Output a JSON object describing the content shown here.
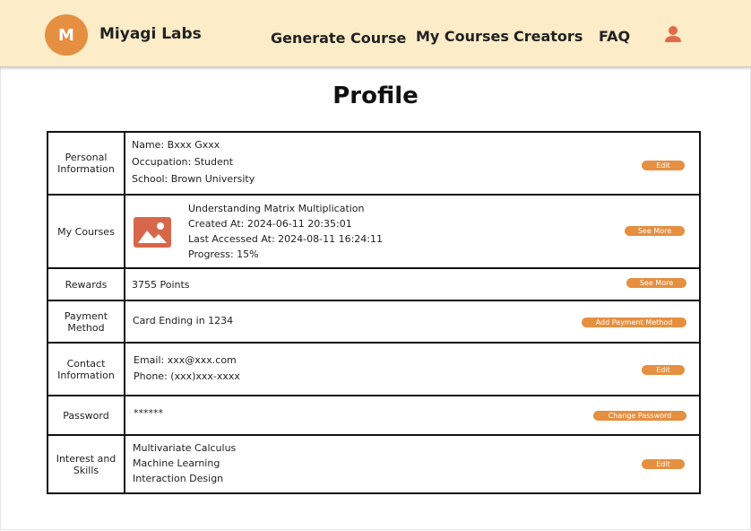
{
  "header": {
    "logo_letter": "M",
    "brand": "Miyagi Labs",
    "nav": {
      "generate_course": "Generate Course",
      "my_courses": "My Courses",
      "creators": "Creators",
      "faq": "FAQ"
    },
    "user_icon": "user-icon"
  },
  "page_title": "Profile",
  "colors": {
    "accent": "#e58f40",
    "header_bg": "#fcecc8",
    "image_placeholder": "#d7674a"
  },
  "sections": {
    "personal": {
      "label": "Personal Information",
      "lines": [
        "Name: Bxxx Gxxx",
        "Occupation: Student",
        "School: Brown University"
      ],
      "button": "Edit"
    },
    "courses": {
      "label": "My Courses",
      "image_icon": "image-icon",
      "lines": [
        "Understanding Matrix Multiplication",
        "Created At: 2024-06-11 20:35:01",
        "Last Accessed At: 2024-08-11 16:24:11",
        "Progress: 15%"
      ],
      "button": "See More"
    },
    "rewards": {
      "label": "Rewards",
      "value": "3755 Points",
      "button": "See More"
    },
    "payment": {
      "label": "Payment Method",
      "value": "Card Ending in 1234",
      "button": "Add Payment Method"
    },
    "contact": {
      "label": "Contact Information",
      "lines": [
        "Email: xxx@xxx.com",
        "Phone: (xxx)xxx-xxxx"
      ],
      "button": "Edit"
    },
    "password": {
      "label": "Password",
      "value": "******",
      "button": "Change Password"
    },
    "interests": {
      "label": "Interest and Skills",
      "lines": [
        "Multivariate Calculus",
        "Machine Learning",
        "Interaction Design"
      ],
      "button": "Edit"
    }
  }
}
